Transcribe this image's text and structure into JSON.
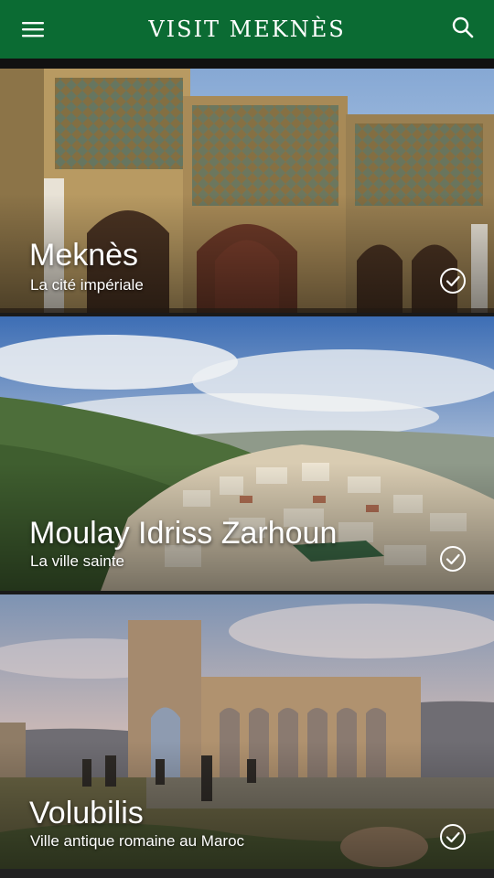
{
  "app_bar": {
    "title": "VISIT MEKNÈS",
    "menu_icon": "hamburger-menu-icon",
    "search_icon": "search-icon",
    "color": "#0b6b33"
  },
  "destinations": [
    {
      "title": "Meknès",
      "subtitle": "La cité impériale",
      "status_icon": "check-circle-icon"
    },
    {
      "title": "Moulay Idriss Zarhoun",
      "subtitle": "La ville sainte",
      "status_icon": "check-circle-icon"
    },
    {
      "title": "Volubilis",
      "subtitle": "Ville antique romaine au Maroc",
      "status_icon": "check-circle-icon"
    }
  ]
}
